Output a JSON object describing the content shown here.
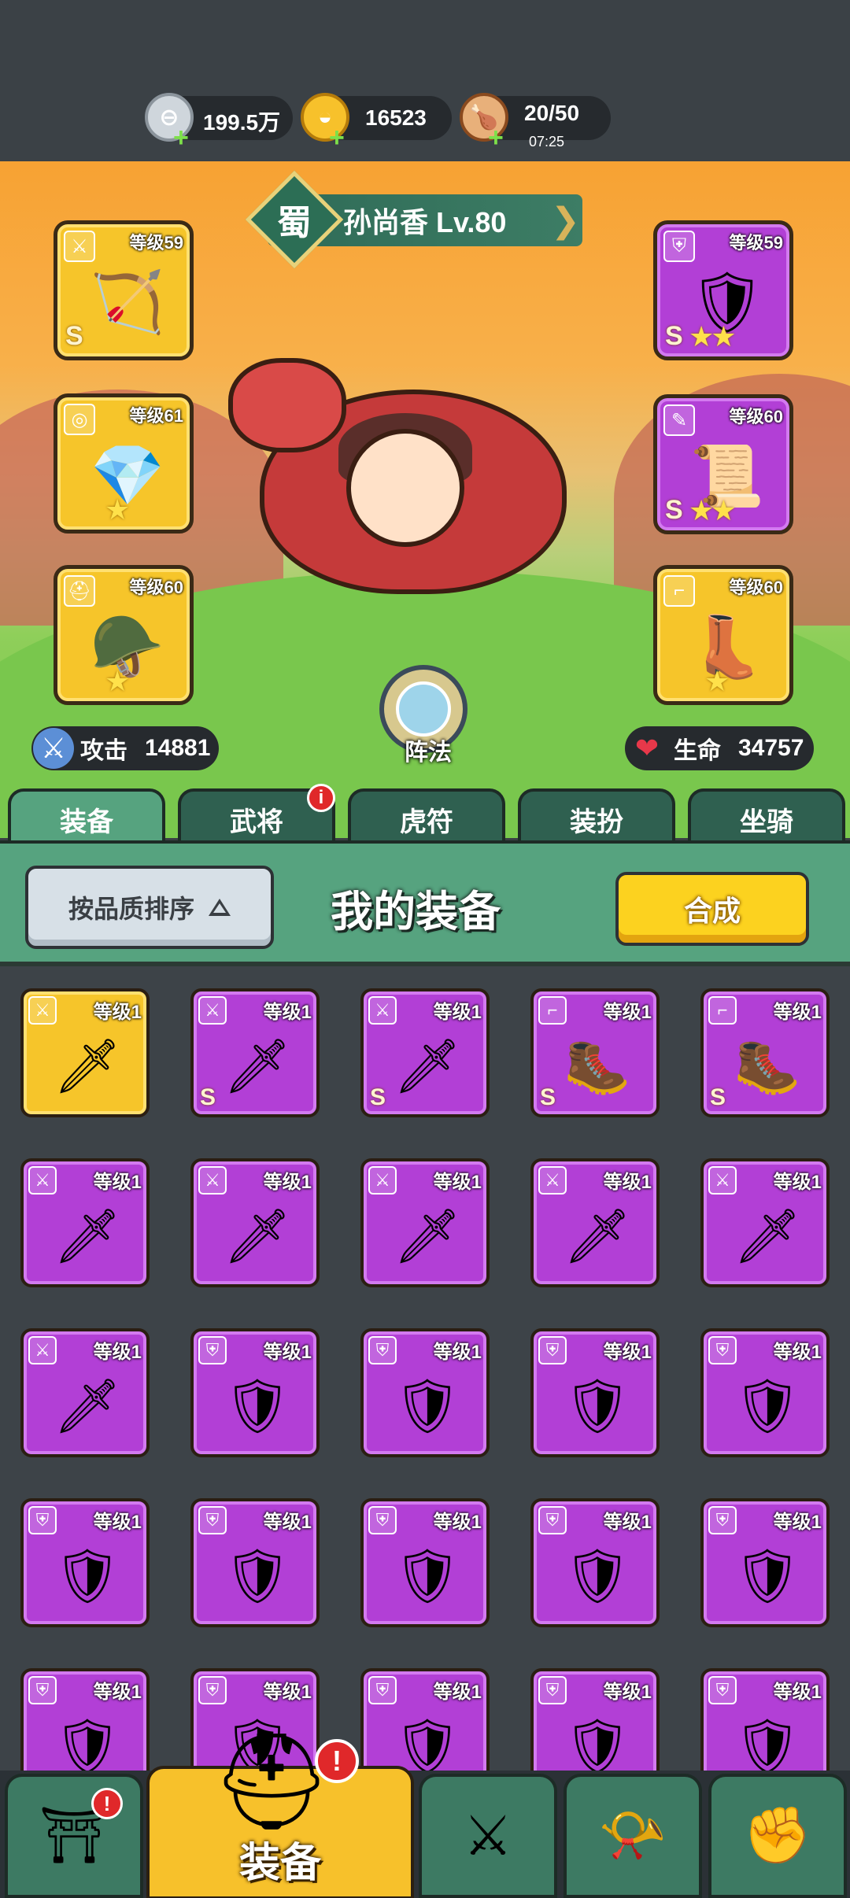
{
  "resources": [
    {
      "name": "silver",
      "icon": "silver-coin-icon",
      "value": "199.5万"
    },
    {
      "name": "gold",
      "icon": "gold-ingot-icon",
      "value": "16523"
    },
    {
      "name": "stamina",
      "icon": "meat-drumstick-icon",
      "value": "20/50",
      "timer": "07:25"
    }
  ],
  "hero": {
    "kingdom": "蜀",
    "name": "孙尚香 Lv.80",
    "formation_label": "阵法",
    "attack_label": "攻击",
    "attack_value": "14881",
    "hp_label": "生命",
    "hp_value": "34757"
  },
  "equipped": {
    "left": [
      {
        "level": "等级59",
        "grade": "S",
        "rarity": "gold",
        "type": "weapon",
        "stars": ""
      },
      {
        "level": "等级61",
        "grade": "",
        "rarity": "gold",
        "type": "accessory",
        "stars": "★"
      },
      {
        "level": "等级60",
        "grade": "",
        "rarity": "gold",
        "type": "helmet",
        "stars": "★"
      }
    ],
    "right": [
      {
        "level": "等级59",
        "grade": "S",
        "rarity": "purple",
        "type": "armor",
        "stars": "★★"
      },
      {
        "level": "等级60",
        "grade": "S",
        "rarity": "purple",
        "type": "book",
        "stars": "★★"
      },
      {
        "level": "等级60",
        "grade": "",
        "rarity": "gold",
        "type": "boots",
        "stars": "★"
      }
    ]
  },
  "tabs": [
    {
      "label": "装备",
      "active": true,
      "badge": ""
    },
    {
      "label": "武将",
      "active": false,
      "badge": "i"
    },
    {
      "label": "虎符",
      "active": false,
      "badge": ""
    },
    {
      "label": "装扮",
      "active": false,
      "badge": ""
    },
    {
      "label": "坐骑",
      "active": false,
      "badge": ""
    }
  ],
  "toolbar": {
    "sort_label": "按品质排序",
    "title": "我的装备",
    "synth_label": "合成"
  },
  "inventory": [
    {
      "level": "等级1",
      "rarity": "gold",
      "grade": "",
      "type": "weapon"
    },
    {
      "level": "等级1",
      "rarity": "purple",
      "grade": "S",
      "type": "weapon"
    },
    {
      "level": "等级1",
      "rarity": "purple",
      "grade": "S",
      "type": "weapon"
    },
    {
      "level": "等级1",
      "rarity": "purple",
      "grade": "S",
      "type": "boots"
    },
    {
      "level": "等级1",
      "rarity": "purple",
      "grade": "S",
      "type": "boots"
    },
    {
      "level": "等级1",
      "rarity": "purple",
      "grade": "",
      "type": "weapon"
    },
    {
      "level": "等级1",
      "rarity": "purple",
      "grade": "",
      "type": "weapon"
    },
    {
      "level": "等级1",
      "rarity": "purple",
      "grade": "",
      "type": "weapon"
    },
    {
      "level": "等级1",
      "rarity": "purple",
      "grade": "",
      "type": "weapon"
    },
    {
      "level": "等级1",
      "rarity": "purple",
      "grade": "",
      "type": "weapon"
    },
    {
      "level": "等级1",
      "rarity": "purple",
      "grade": "",
      "type": "weapon"
    },
    {
      "level": "等级1",
      "rarity": "purple",
      "grade": "",
      "type": "armor"
    },
    {
      "level": "等级1",
      "rarity": "purple",
      "grade": "",
      "type": "armor"
    },
    {
      "level": "等级1",
      "rarity": "purple",
      "grade": "",
      "type": "armor"
    },
    {
      "level": "等级1",
      "rarity": "purple",
      "grade": "",
      "type": "armor"
    },
    {
      "level": "等级1",
      "rarity": "purple",
      "grade": "",
      "type": "armor"
    },
    {
      "level": "等级1",
      "rarity": "purple",
      "grade": "",
      "type": "armor"
    },
    {
      "level": "等级1",
      "rarity": "purple",
      "grade": "",
      "type": "armor"
    },
    {
      "level": "等级1",
      "rarity": "purple",
      "grade": "",
      "type": "armor"
    },
    {
      "level": "等级1",
      "rarity": "purple",
      "grade": "",
      "type": "armor"
    },
    {
      "level": "等级1",
      "rarity": "purple",
      "grade": "",
      "type": "armor"
    },
    {
      "level": "等级1",
      "rarity": "purple",
      "grade": "",
      "type": "armor"
    },
    {
      "level": "等级1",
      "rarity": "purple",
      "grade": "",
      "type": "armor"
    },
    {
      "level": "等级1",
      "rarity": "purple",
      "grade": "",
      "type": "armor"
    },
    {
      "level": "等级1",
      "rarity": "purple",
      "grade": "",
      "type": "armor"
    }
  ],
  "bottom_nav": [
    {
      "icon": "shop-gate-icon",
      "badge": "!"
    },
    {
      "icon": "helmet-icon",
      "label": "装备",
      "badge": "!",
      "active": true
    },
    {
      "icon": "crossed-swords-shield-icon",
      "badge": ""
    },
    {
      "icon": "war-horn-icon",
      "badge": ""
    },
    {
      "icon": "fist-upgrade-icon",
      "badge": ""
    }
  ],
  "colors": {
    "gold_rarity": "#f6c52a",
    "purple_rarity": "#b23fd6",
    "tab_active": "#56a37f",
    "badge_red": "#e0282a",
    "button_yellow": "#fcd21f"
  }
}
